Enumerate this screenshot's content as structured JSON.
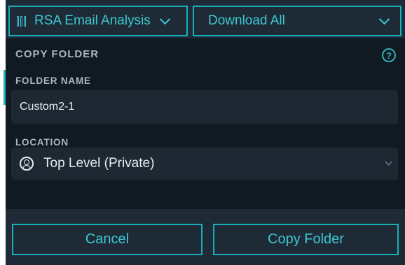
{
  "toolbar": {
    "view_label": "RSA Email Analysis",
    "download_label": "Download All"
  },
  "dialog": {
    "title": "COPY FOLDER",
    "help_glyph": "?",
    "folder_name_label": "FOLDER NAME",
    "folder_name_value": "Custom2-1",
    "location_label": "LOCATION",
    "location_value": "Top Level (Private)",
    "cancel_label": "Cancel",
    "submit_label": "Copy Folder"
  },
  "colors": {
    "accent": "#19b0ba",
    "panel_bg": "#111a22",
    "bar_bg": "#1e2a36",
    "field_bg": "#1d2833"
  },
  "icons": [
    "columns-icon",
    "chevron-down-icon",
    "help-icon",
    "user-circle-icon"
  ]
}
